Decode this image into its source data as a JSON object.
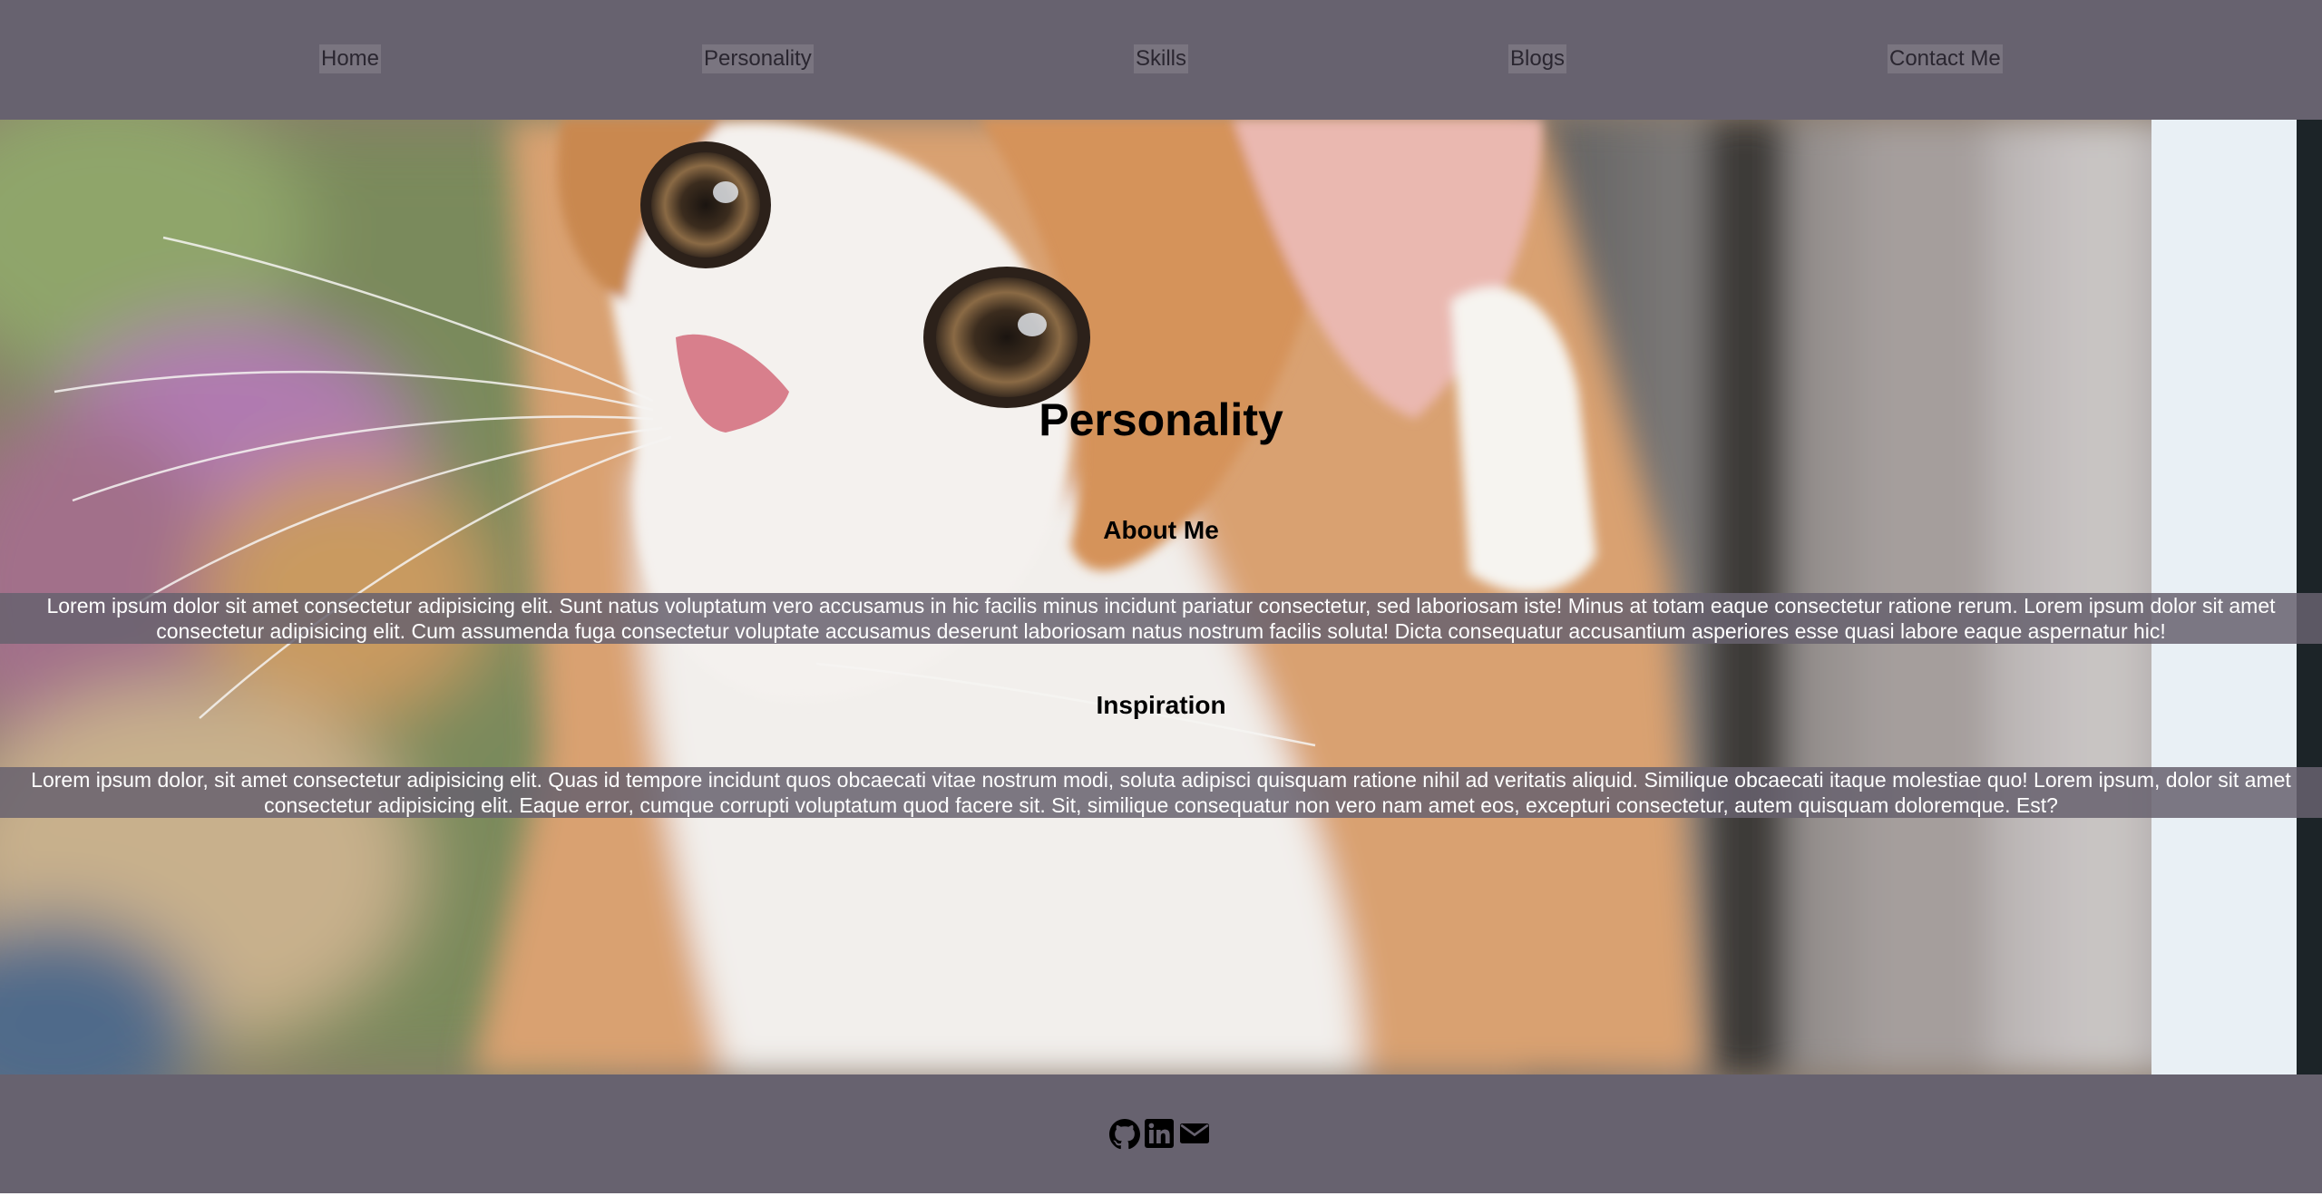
{
  "nav": {
    "items": [
      {
        "label": "Home"
      },
      {
        "label": "Personality"
      },
      {
        "label": "Skills"
      },
      {
        "label": "Blogs"
      },
      {
        "label": "Contact Me"
      }
    ]
  },
  "main": {
    "title": "Personality",
    "sections": [
      {
        "heading": "About Me",
        "text": "Lorem ipsum dolor sit amet consectetur adipisicing elit. Sunt natus voluptatum vero accusamus in hic facilis minus incidunt pariatur consectetur, sed laboriosam iste! Minus at totam eaque consectetur ratione rerum. Lorem ipsum dolor sit amet consectetur adipisicing elit. Cum assumenda fuga consectetur voluptate accusamus deserunt laboriosam natus nostrum facilis soluta! Dicta consequatur accusantium asperiores esse quasi labore eaque aspernatur hic!"
      },
      {
        "heading": "Inspiration",
        "text": "Lorem ipsum dolor, sit amet consectetur adipisicing elit. Quas id tempore incidunt quos obcaecati vitae nostrum modi, soluta adipisci quisquam ratione nihil ad veritatis aliquid. Similique obcaecati itaque molestiae quo! Lorem ipsum, dolor sit amet consectetur adipisicing elit. Eaque error, cumque corrupti voluptatum quod facere sit. Sit, similique consequatur non vero nam amet eos, excepturi consectetur, autem quisquam doloremque. Est?"
      }
    ]
  },
  "footer": {
    "icons": [
      {
        "name": "github-icon"
      },
      {
        "name": "linkedin-icon"
      },
      {
        "name": "envelope-icon"
      }
    ]
  },
  "colors": {
    "nav_bg": "#67626f",
    "footer_bg": "#67626f",
    "text_band": "#67626f",
    "link_bg": "#7a7580"
  }
}
